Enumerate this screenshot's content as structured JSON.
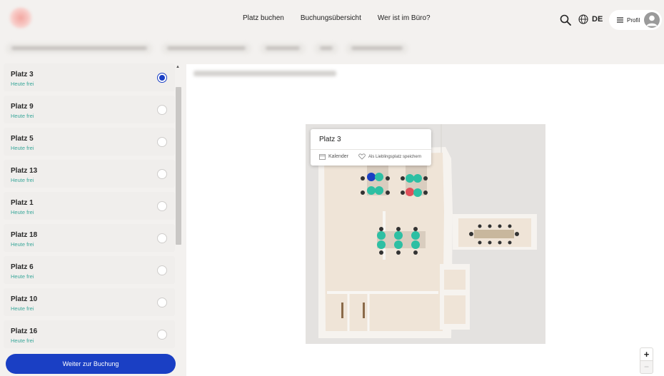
{
  "header": {
    "nav": [
      {
        "label": "Platz buchen"
      },
      {
        "label": "Buchungsübersicht"
      },
      {
        "label": "Wer ist im Büro?"
      }
    ],
    "language": "DE",
    "profile_label": "Profil"
  },
  "desks": [
    {
      "title": "Platz 3",
      "status": "Heute frei",
      "selected": true
    },
    {
      "title": "Platz 9",
      "status": "Heute frei",
      "selected": false
    },
    {
      "title": "Platz 5",
      "status": "Heute frei",
      "selected": false
    },
    {
      "title": "Platz 13",
      "status": "Heute frei",
      "selected": false
    },
    {
      "title": "Platz 1",
      "status": "Heute frei",
      "selected": false
    },
    {
      "title": "Platz 18",
      "status": "Heute frei",
      "selected": false
    },
    {
      "title": "Platz 6",
      "status": "Heute frei",
      "selected": false
    },
    {
      "title": "Platz 10",
      "status": "Heute frei",
      "selected": false
    },
    {
      "title": "Platz 16",
      "status": "Heute frei",
      "selected": false
    }
  ],
  "continue_label": "Weiter zur Buchung",
  "popup": {
    "title": "Platz 3",
    "calendar_label": "Kalender",
    "favorite_label": "Als Lieblingsplatz speichern"
  },
  "map": {
    "zoom_in": "+",
    "zoom_out": "−"
  },
  "colors": {
    "primary": "#1a3fc4",
    "free_desk": "#2dbfa3",
    "status_text": "#3aa79a",
    "occupied": "#e0505a"
  }
}
